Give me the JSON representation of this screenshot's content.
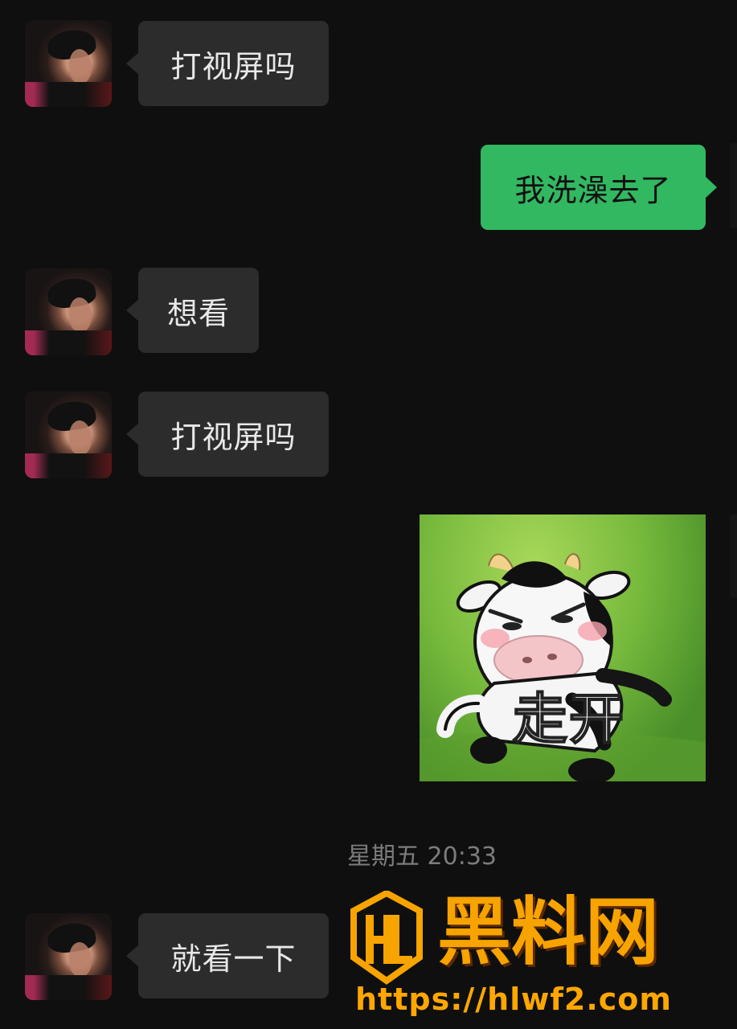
{
  "messages": [
    {
      "side": "left",
      "text": "打视屏吗"
    },
    {
      "side": "right",
      "text": "我洗澡去了"
    },
    {
      "side": "left",
      "text": "想看"
    },
    {
      "side": "left",
      "text": "打视屏吗"
    },
    {
      "side": "right",
      "type": "sticker",
      "caption": "走开"
    },
    {
      "side": "left",
      "text": "就看一下"
    }
  ],
  "timestamp": "星期五 20:33",
  "watermark": {
    "logo_letters": "HL",
    "name": "黑料网",
    "url": "https://hlwf2.com"
  },
  "colors": {
    "background": "#0f0f0f",
    "incoming_bubble": "#2c2c2c",
    "outgoing_bubble": "#32b861",
    "watermark": "#f7a300"
  }
}
